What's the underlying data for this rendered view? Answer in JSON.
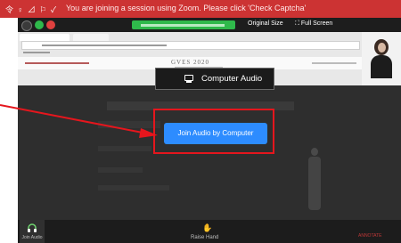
{
  "notification": {
    "icons": "令 ♀ ⊿ ⚐ ✓",
    "message": "You are joining a session using Zoom. Please click 'Check Captcha'"
  },
  "share_banner": {
    "original_size": "Original Size",
    "full_screen": "⛶ Full Screen"
  },
  "shared_page": {
    "brand_title": "GVES 2020"
  },
  "audio_tab": {
    "label": "Computer Audio"
  },
  "join_button": {
    "label": "Join Audio by Computer"
  },
  "toolbar": {
    "join_audio_label": "Join Audio",
    "raise_hand_label": "Raise Hand",
    "watermark": "ANNOTATE"
  },
  "colors": {
    "notification_bar": "#cc3333",
    "share_banner": "#2fb94b",
    "join_button": "#2d8cff",
    "annotation": "#e5161d"
  },
  "icons": {
    "audio_tab": "computer-monitor-icon",
    "join_audio": "headphone-icon",
    "raise_hand": "raise-hand-icon"
  }
}
